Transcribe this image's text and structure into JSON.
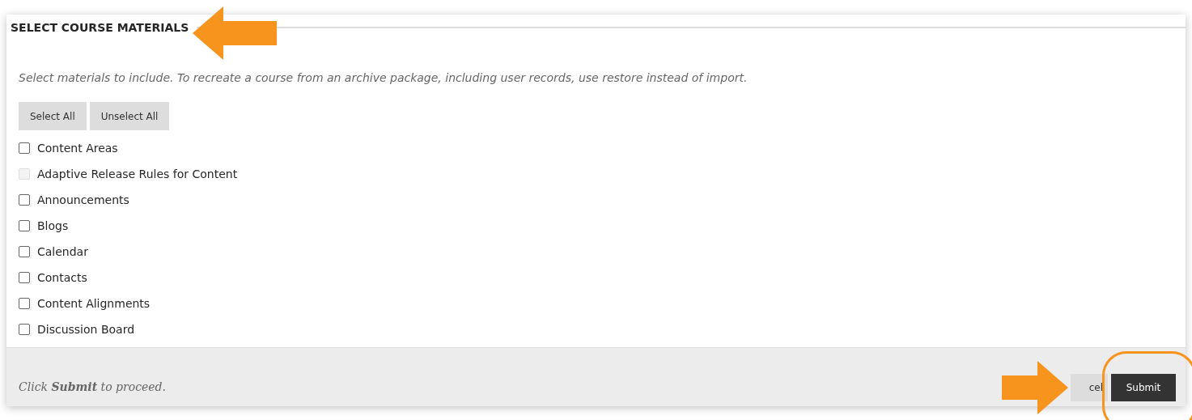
{
  "section": {
    "title": "SELECT COURSE MATERIALS",
    "instructions": "Select materials to include. To recreate a course from an archive package, including user records, use restore instead of import."
  },
  "buttons": [
    "Select All",
    "Unselect All"
  ],
  "materials": [
    {
      "label": "Content Areas",
      "checked": false,
      "disabled": false
    },
    {
      "label": "Adaptive Release Rules for Content",
      "checked": false,
      "disabled": true
    },
    {
      "label": "Announcements",
      "checked": false,
      "disabled": false
    },
    {
      "label": "Blogs",
      "checked": false,
      "disabled": false
    },
    {
      "label": "Calendar",
      "checked": false,
      "disabled": false
    },
    {
      "label": "Contacts",
      "checked": false,
      "disabled": false
    },
    {
      "label": "Content Alignments",
      "checked": false,
      "disabled": false
    },
    {
      "label": "Discussion Board",
      "checked": false,
      "disabled": false
    }
  ],
  "footer": {
    "hint": "Click **Submit** to proceed.",
    "cancel_button": "cel",
    "submit_button": "Submit"
  }
}
